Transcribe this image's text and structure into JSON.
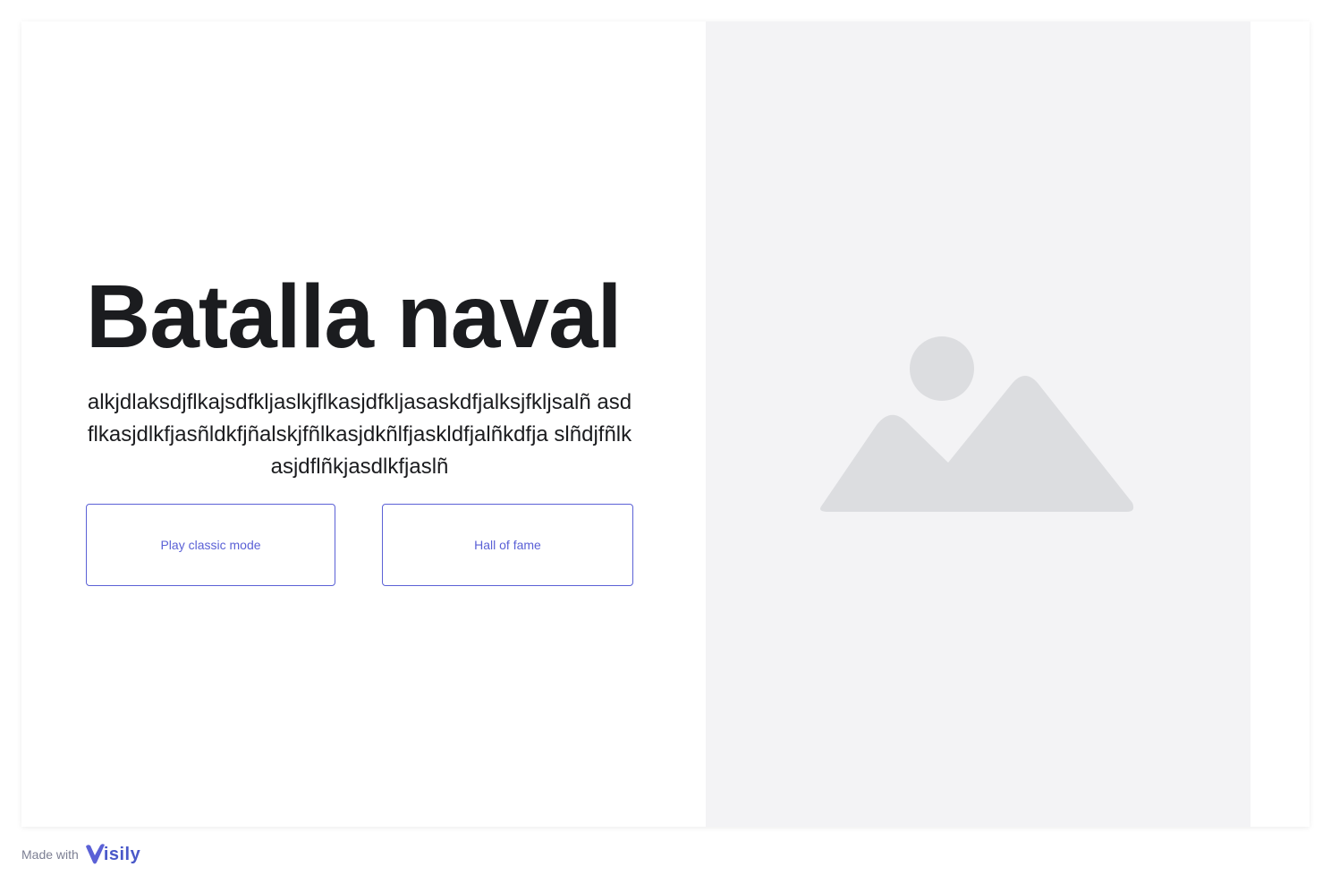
{
  "hero": {
    "title": "Batalla naval",
    "description": "alkjdlaksdjflkajsdfkljaslkjflkasjdfkljasaskdfjalksjfkljsalñ asdflkasjdlkfjasñldkfjñalskjfñlkasjdkñlfjaskldfjalñkdfja slñdjfñlkasjdflñkjasdlkfjaslñ"
  },
  "buttons": {
    "classic_label": "Play classic mode",
    "fame_label": "Hall of fame"
  },
  "image_panel": {
    "icon": "image-placeholder-icon",
    "background": "#f3f3f5",
    "icon_color": "#dcdde0"
  },
  "footer": {
    "made_with": "Made with",
    "brand_icon": "visily-logo-icon",
    "brand_text": "isily"
  },
  "colors": {
    "accent": "#5b61d6",
    "title": "#1b1c1f",
    "brand": "#4a59c9"
  }
}
